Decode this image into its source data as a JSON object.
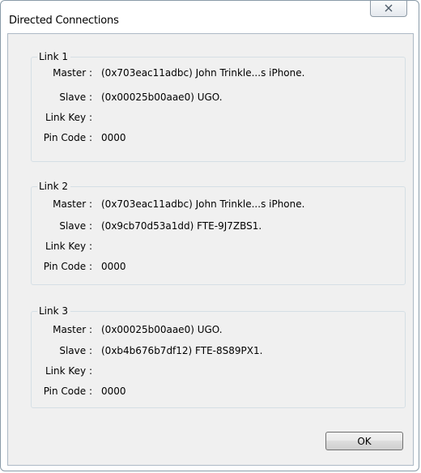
{
  "window": {
    "title": "Directed Connections"
  },
  "links": [
    {
      "label": "Link 1",
      "master_label": "Master :",
      "master_value": "(0x703eac11adbc) John Trinkle...s iPhone.",
      "slave_label": "Slave :",
      "slave_value": "(0x00025b00aae0) UGO.",
      "linkkey_label": "Link Key :",
      "linkkey_value": "",
      "pincode_label": "Pin Code :",
      "pincode_value": "0000"
    },
    {
      "label": "Link 2",
      "master_label": "Master :",
      "master_value": "(0x703eac11adbc) John Trinkle...s iPhone.",
      "slave_label": "Slave :",
      "slave_value": "(0x9cb70d53a1dd) FTE-9J7ZBS1.",
      "linkkey_label": "Link Key :",
      "linkkey_value": "",
      "pincode_label": "Pin Code :",
      "pincode_value": "0000"
    },
    {
      "label": "Link 3",
      "master_label": "Master :",
      "master_value": "(0x00025b00aae0) UGO.",
      "slave_label": "Slave :",
      "slave_value": "(0xb4b676b7df12) FTE-8S89PX1.",
      "linkkey_label": "Link Key :",
      "linkkey_value": "",
      "pincode_label": "Pin Code :",
      "pincode_value": "0000"
    }
  ],
  "buttons": {
    "ok_label": "OK"
  },
  "icons": {
    "close": "close-icon"
  }
}
